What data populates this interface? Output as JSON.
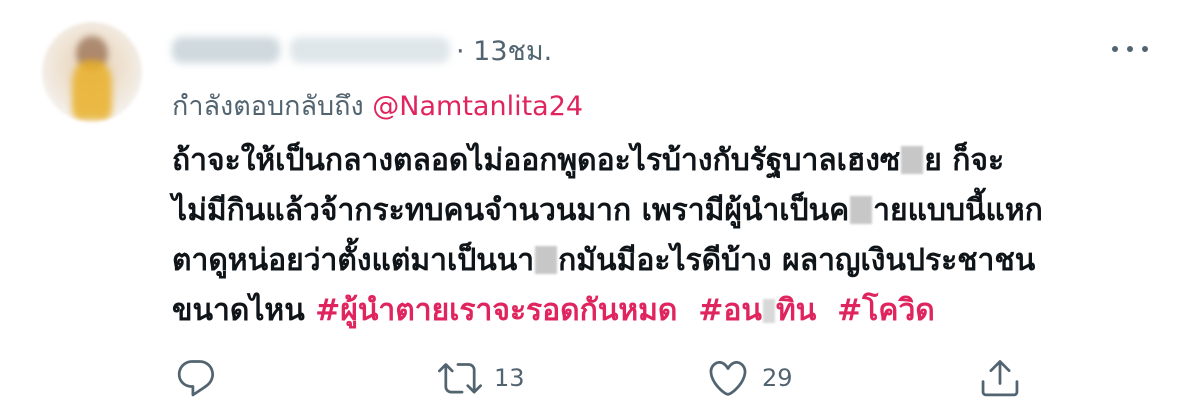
{
  "header": {
    "timestamp": "· 13ชม."
  },
  "reply": {
    "prefix": "กำลังตอบกลับถึง",
    "mention": "@Namtanlita24"
  },
  "tweet": {
    "line1a": "ถ้าจะให้เป็นกลางตลอดไม่ออกพูดอะไรบ้างกับรัฐบาลเฮงซ",
    "line1b": "ย ก็จะ",
    "line2a": "ไม่มีกินแล้วจ้ากระทบคนจำนวนมาก เพรามีผู้นำเป็นค",
    "line2b": "ายแบบนี้แหก",
    "line3a": "ตาดูหน่อยว่าตั้งแต่มาเป็นนา",
    "line3b": "กมันมีอะไรดีบ้าง ผลาญเงินประชาชน",
    "line4": "ขนาดไหน",
    "hashtag1": "#ผู้นำตายเราจะรอดกันหมด",
    "hashtag2a": "#อน",
    "hashtag2b": "ทิน",
    "hashtag3": "#โควิด"
  },
  "actions": {
    "reply_icon": "reply-icon",
    "retweet_icon": "retweet-icon",
    "retweet_count": "13",
    "like_icon": "heart-icon",
    "like_count": "29",
    "share_icon": "share-icon"
  },
  "colors": {
    "accent": "#e0245e",
    "secondary_text": "#536471",
    "primary_text": "#0f1419"
  }
}
